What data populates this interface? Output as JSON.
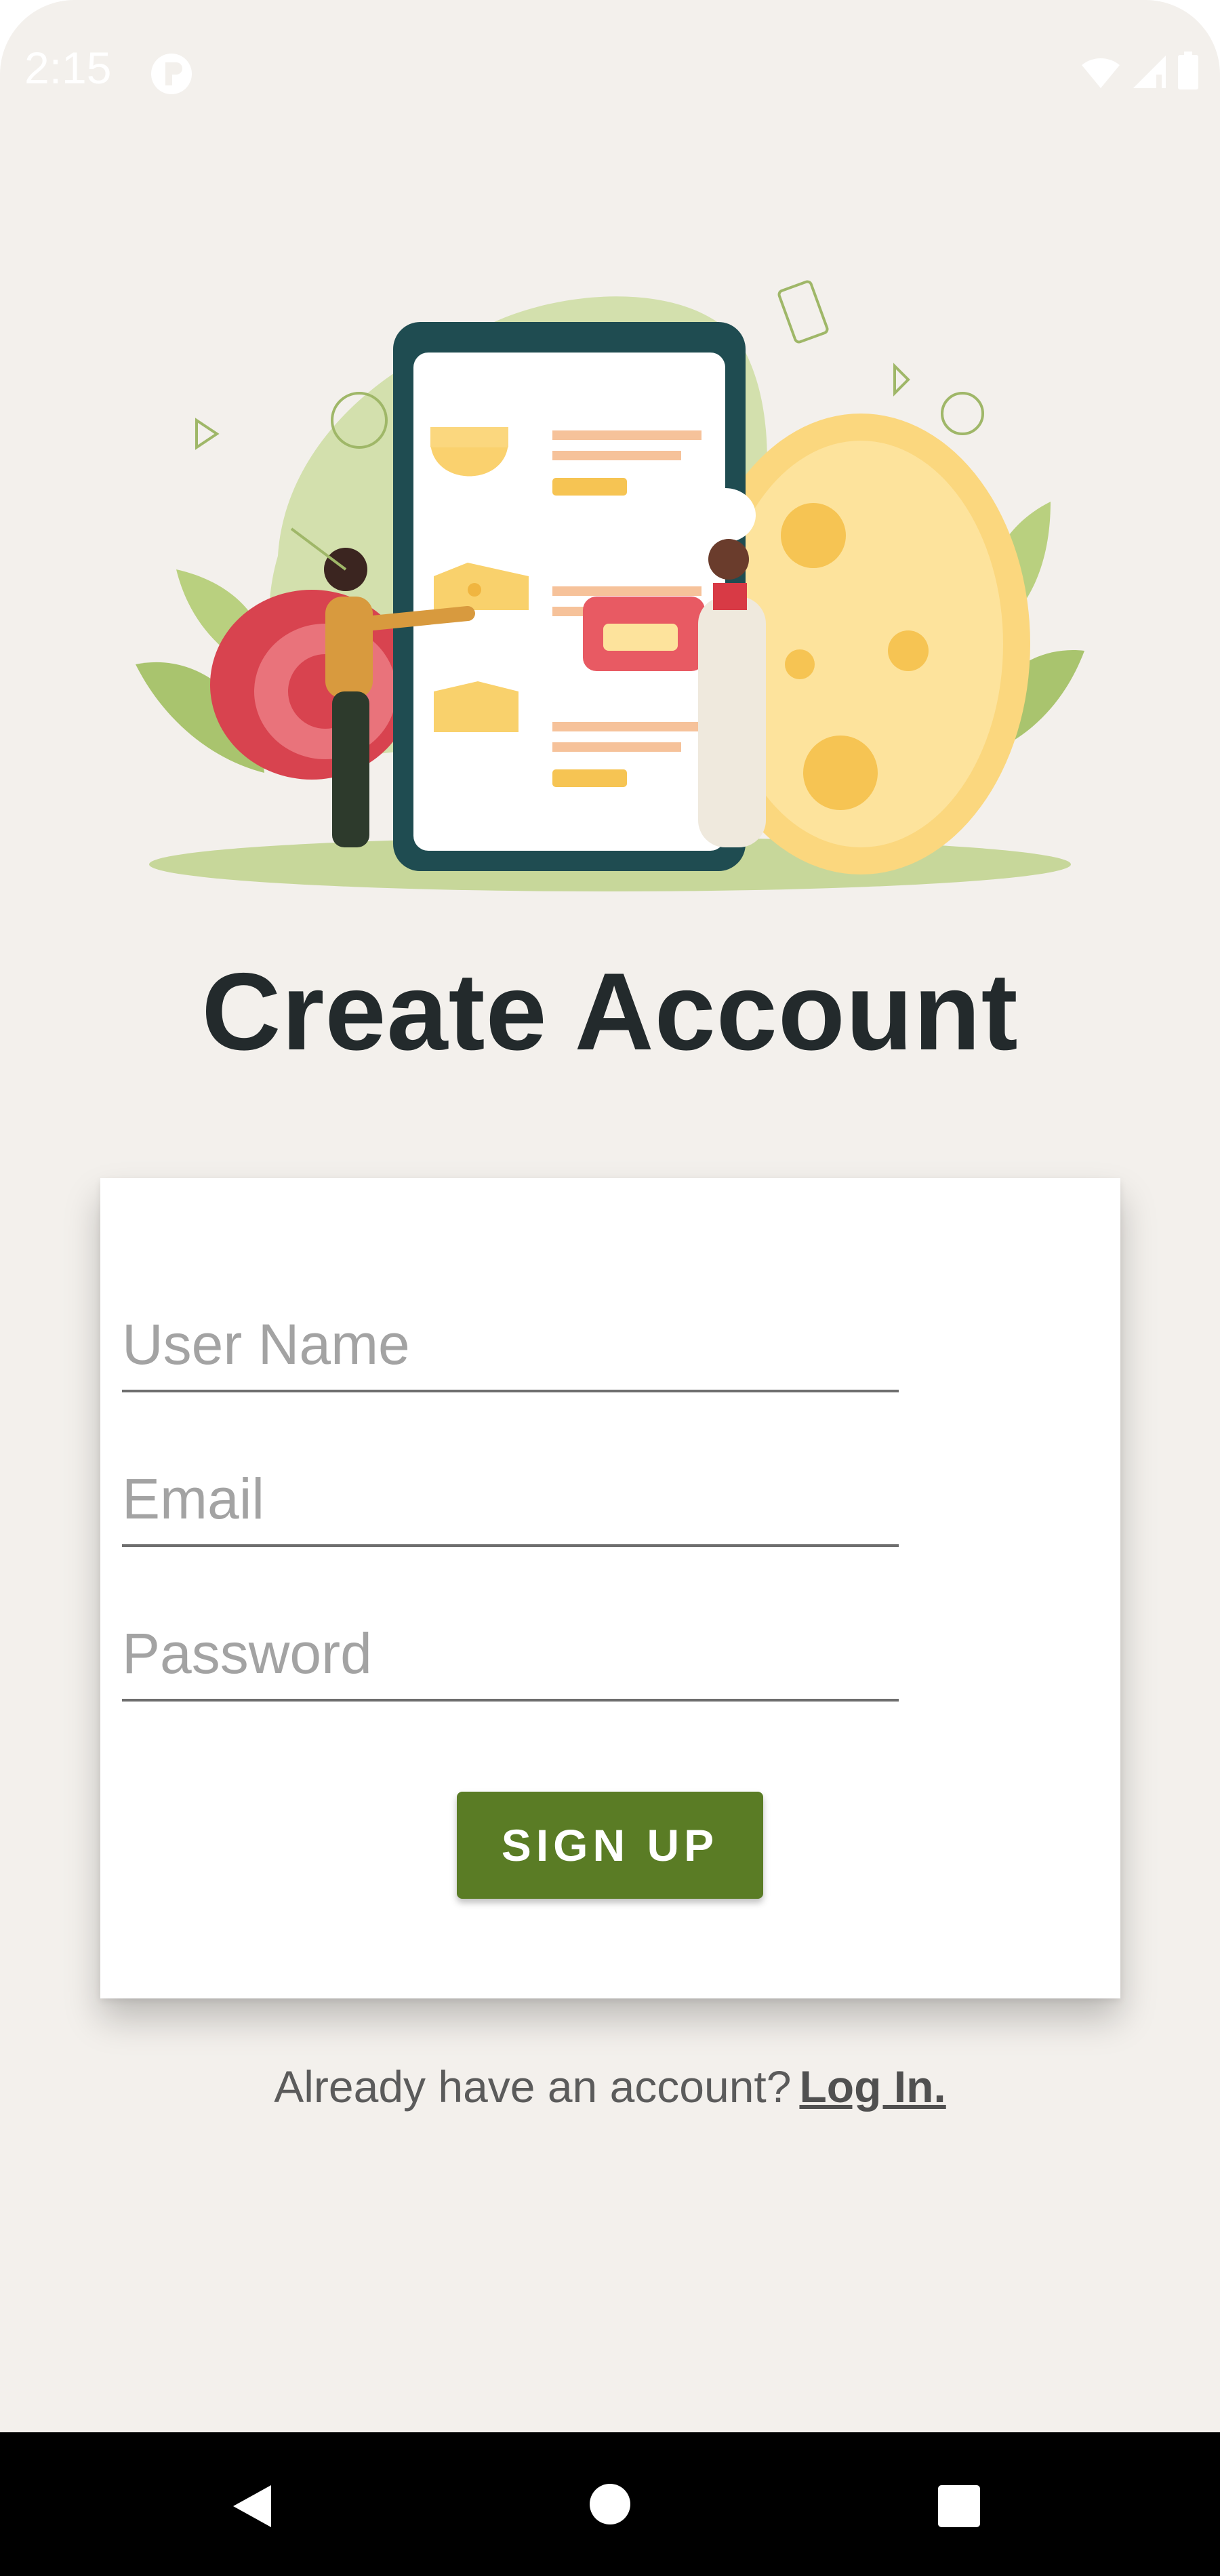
{
  "status_bar": {
    "time": "2:15",
    "icons": [
      "app-notification-icon",
      "wifi-icon",
      "signal-icon",
      "battery-icon"
    ]
  },
  "illustration": {
    "description_icon": "cheese-shop-illustration"
  },
  "page": {
    "title": "Create Account"
  },
  "form": {
    "username_placeholder": "User Name",
    "email_placeholder": "Email",
    "password_placeholder": "Password",
    "username_value": "",
    "email_value": "",
    "password_value": "",
    "signup_label": "SIGN UP"
  },
  "footer": {
    "prompt": "Already have an account?",
    "login_label": "Log In."
  },
  "nav_bar": {
    "icons": [
      "back-icon",
      "home-icon",
      "recents-icon"
    ]
  },
  "colors": {
    "background": "#f3f0ec",
    "accent": "#5a7c25",
    "title": "#232a2c",
    "card": "#ffffff"
  }
}
